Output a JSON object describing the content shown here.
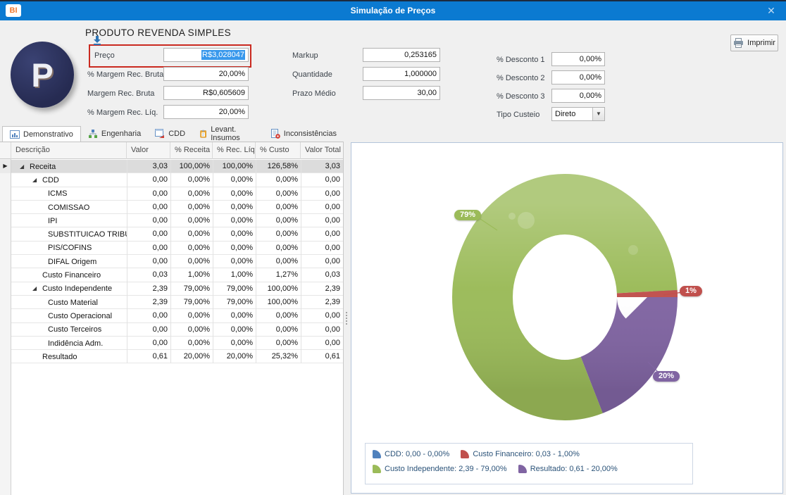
{
  "window": {
    "title": "Simulação de Preços",
    "logo": "BI",
    "close_glyph": "✕"
  },
  "header": {
    "product_title": "PRODUTO REVENDA SIMPLES",
    "avatar_letter": "P",
    "print_button_label": "Imprimir",
    "fields": {
      "preco": {
        "label": "Preço",
        "value": "R$3,028047"
      },
      "margem_bruta_pct": {
        "label": "% Margem Rec. Bruta",
        "value": "20,00%"
      },
      "margem_bruta": {
        "label": "Margem Rec. Bruta",
        "value": "R$0,605609"
      },
      "margem_liq_pct": {
        "label": "% Margem Rec. Líq.",
        "value": "20,00%"
      },
      "markup": {
        "label": "Markup",
        "value": "0,253165"
      },
      "quantidade": {
        "label": "Quantidade",
        "value": "1,000000"
      },
      "prazo_medio": {
        "label": "Prazo Médio",
        "value": "30,00"
      },
      "desconto1": {
        "label": "% Desconto 1",
        "value": "0,00%"
      },
      "desconto2": {
        "label": "% Desconto 2",
        "value": "0,00%"
      },
      "desconto3": {
        "label": "% Desconto 3",
        "value": "0,00%"
      },
      "tipo_custeio": {
        "label": "Tipo Custeio",
        "value": "Direto"
      }
    }
  },
  "tabs": [
    {
      "label": "Demonstrativo",
      "icon": "chart-grid-icon",
      "active": true
    },
    {
      "label": "Engenharia",
      "icon": "org-tree-icon",
      "active": false
    },
    {
      "label": "CDD",
      "icon": "form-arrow-icon",
      "active": false
    },
    {
      "label": "Levant. Insumos",
      "icon": "clipboard-icon",
      "active": false
    },
    {
      "label": "Inconsistências",
      "icon": "document-error-icon",
      "active": false
    }
  ],
  "table": {
    "columns": [
      "Descrição",
      "Valor",
      "% Receita",
      "% Rec. Líq...",
      "% Custo",
      "Valor Total"
    ],
    "rows": [
      {
        "label": "Receita",
        "indent": 0,
        "expanded": true,
        "current": true,
        "selected": true,
        "values": [
          "3,03",
          "100,00%",
          "100,00%",
          "126,58%",
          "3,03"
        ]
      },
      {
        "label": "CDD",
        "indent": 1,
        "expanded": true,
        "values": [
          "0,00",
          "0,00%",
          "0,00%",
          "0,00%",
          "0,00"
        ]
      },
      {
        "label": "ICMS",
        "indent": 2,
        "values": [
          "0,00",
          "0,00%",
          "0,00%",
          "0,00%",
          "0,00"
        ]
      },
      {
        "label": "COMISSAO",
        "indent": 2,
        "values": [
          "0,00",
          "0,00%",
          "0,00%",
          "0,00%",
          "0,00"
        ]
      },
      {
        "label": "IPI",
        "indent": 2,
        "values": [
          "0,00",
          "0,00%",
          "0,00%",
          "0,00%",
          "0,00"
        ]
      },
      {
        "label": "SUBSTITUICAO TRIBU...",
        "indent": 2,
        "values": [
          "0,00",
          "0,00%",
          "0,00%",
          "0,00%",
          "0,00"
        ]
      },
      {
        "label": "PIS/COFINS",
        "indent": 2,
        "values": [
          "0,00",
          "0,00%",
          "0,00%",
          "0,00%",
          "0,00"
        ]
      },
      {
        "label": "DIFAL Origem",
        "indent": 2,
        "values": [
          "0,00",
          "0,00%",
          "0,00%",
          "0,00%",
          "0,00"
        ]
      },
      {
        "label": "Custo Financeiro",
        "indent": 1,
        "values": [
          "0,03",
          "1,00%",
          "1,00%",
          "1,27%",
          "0,03"
        ]
      },
      {
        "label": "Custo Independente",
        "indent": 1,
        "expanded": true,
        "values": [
          "2,39",
          "79,00%",
          "79,00%",
          "100,00%",
          "2,39"
        ]
      },
      {
        "label": "Custo Material",
        "indent": 2,
        "values": [
          "2,39",
          "79,00%",
          "79,00%",
          "100,00%",
          "2,39"
        ]
      },
      {
        "label": "Custo Operacional",
        "indent": 2,
        "values": [
          "0,00",
          "0,00%",
          "0,00%",
          "0,00%",
          "0,00"
        ]
      },
      {
        "label": "Custo Terceiros",
        "indent": 2,
        "values": [
          "0,00",
          "0,00%",
          "0,00%",
          "0,00%",
          "0,00"
        ]
      },
      {
        "label": "Indidência Adm.",
        "indent": 2,
        "values": [
          "0,00",
          "0,00%",
          "0,00%",
          "0,00%",
          "0,00"
        ]
      },
      {
        "label": "Resultado",
        "indent": 1,
        "values": [
          "0,61",
          "20,00%",
          "20,00%",
          "25,32%",
          "0,61"
        ]
      }
    ]
  },
  "chart_data": {
    "type": "pie",
    "donut": true,
    "legend_position": "bottom",
    "slices": [
      {
        "name": "CDD",
        "value": 0.0,
        "pct": 0,
        "value_display": "0,00",
        "pct_display": "0,00%",
        "badge": "",
        "color": "#4f81bd"
      },
      {
        "name": "Custo Financeiro",
        "value": 0.03,
        "pct": 1,
        "value_display": "0,03",
        "pct_display": "1,00%",
        "badge": "1%",
        "color": "#c0504d"
      },
      {
        "name": "Custo Independente",
        "value": 2.39,
        "pct": 79,
        "value_display": "2,39",
        "pct_display": "79,00%",
        "badge": "79%",
        "color": "#9bbb59"
      },
      {
        "name": "Resultado",
        "value": 0.61,
        "pct": 20,
        "value_display": "0,61",
        "pct_display": "20,00%",
        "badge": "20%",
        "color": "#8064a2"
      }
    ],
    "draw_order": [
      "Resultado",
      "Custo Independente",
      "Custo Financeiro"
    ]
  }
}
